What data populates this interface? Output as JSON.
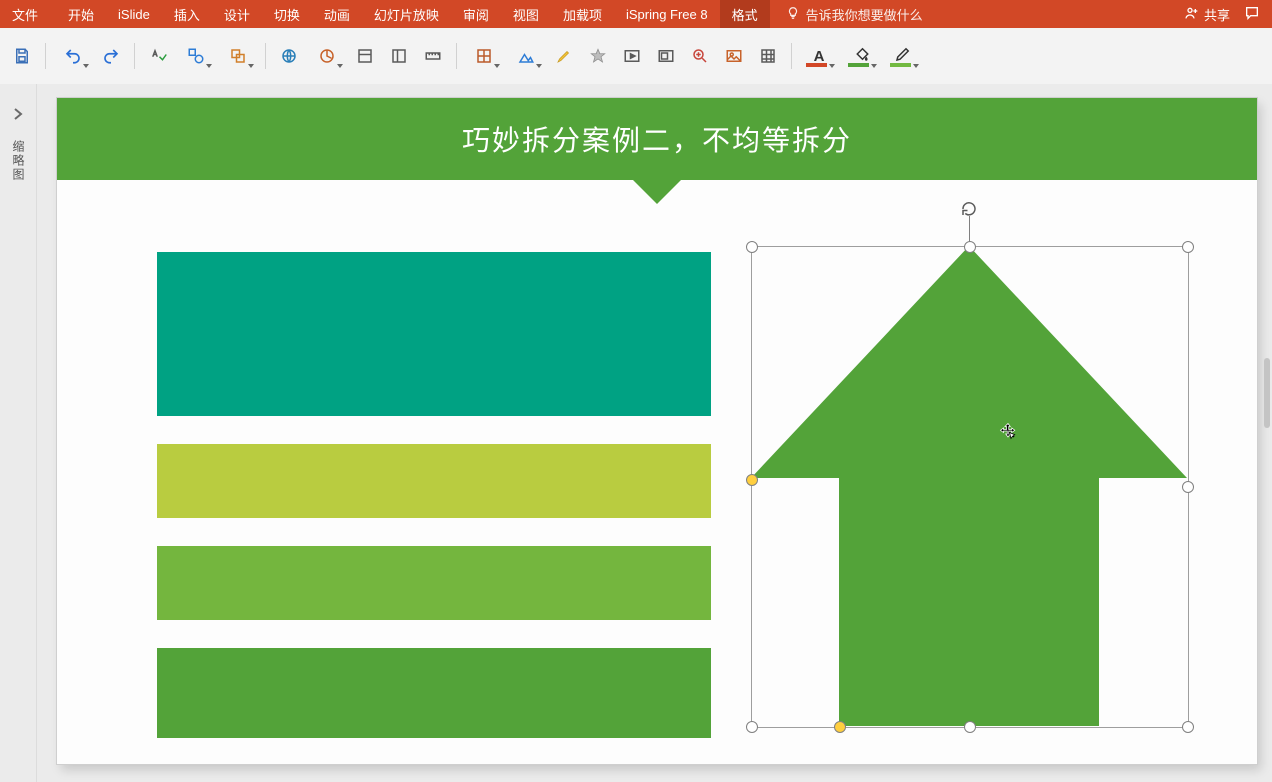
{
  "ribbon": {
    "tabs": {
      "file": "文件",
      "home": "开始",
      "islide": "iSlide",
      "insert": "插入",
      "design": "设计",
      "trans": "切换",
      "anim": "动画",
      "show": "幻灯片放映",
      "review": "审阅",
      "view": "视图",
      "addins": "加载项",
      "ispring": "iSpring Free 8",
      "format": "格式"
    },
    "tell_me": "告诉我你想要做什么",
    "share": "共享"
  },
  "side_panel_label": "缩略图",
  "slide": {
    "title": "巧妙拆分案例二，不均等拆分"
  },
  "colors": {
    "font_underline": "#d24726",
    "fill_underline": "#53a339",
    "outline_underline": "#72b940"
  }
}
